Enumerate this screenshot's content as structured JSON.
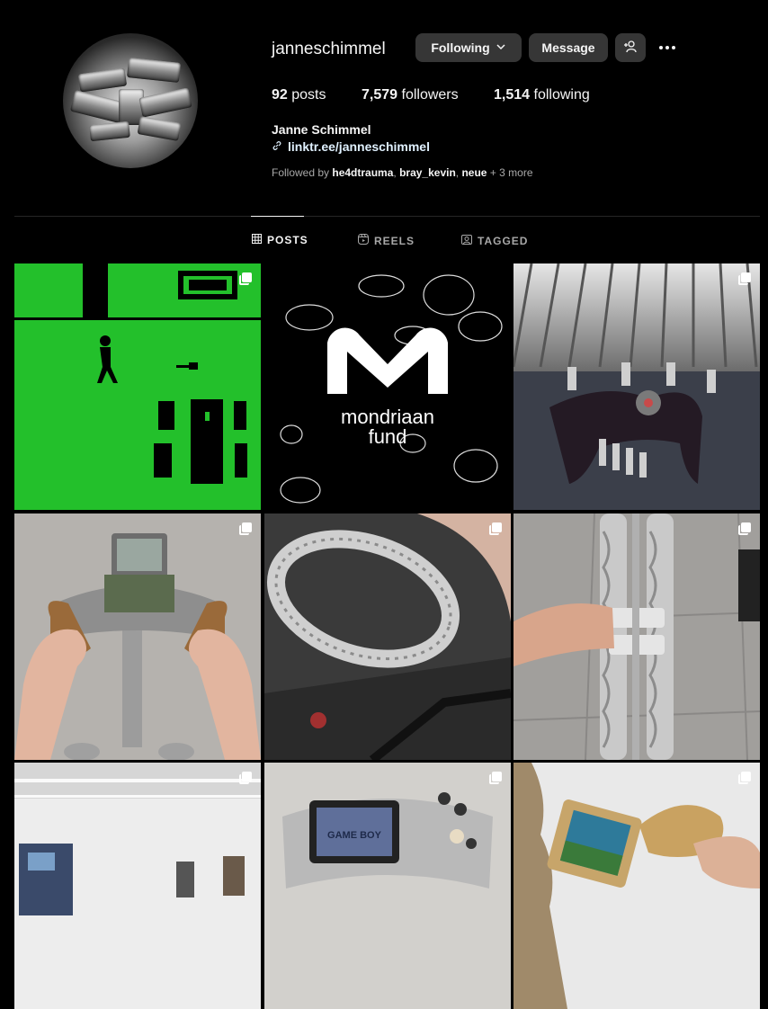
{
  "profile": {
    "username": "janneschimmel",
    "full_name": "Janne Schimmel",
    "link": "linktr.ee/janneschimmel",
    "stats": {
      "posts_count": "92",
      "posts_label": "posts",
      "followers_count": "7,579",
      "followers_label": "followers",
      "following_count": "1,514",
      "following_label": "following"
    },
    "followed_by": {
      "prefix": "Followed by",
      "users": [
        "he4dtrauma",
        "bray_kevin",
        "neue"
      ],
      "more": "+ 3 more"
    }
  },
  "actions": {
    "following_label": "Following",
    "message_label": "Message"
  },
  "tabs": [
    {
      "label": "POSTS",
      "icon": "grid-icon",
      "active": true
    },
    {
      "label": "REELS",
      "icon": "reels-icon",
      "active": false
    },
    {
      "label": "TAGGED",
      "icon": "tagged-icon",
      "active": false
    }
  ],
  "posts": [
    {
      "desc": "green pixel game screen",
      "multi": true
    },
    {
      "desc": "mondriaan fund graphic",
      "text": "mondriaan fund",
      "multi": false
    },
    {
      "desc": "aluminium radiator sculpture",
      "multi": true
    },
    {
      "desc": "metal game controller sculpture",
      "multi": true
    },
    {
      "desc": "cast metal chair ring",
      "multi": true
    },
    {
      "desc": "cast metal door handles",
      "multi": true
    },
    {
      "desc": "gallery installation",
      "multi": true
    },
    {
      "desc": "game boy sculpture",
      "gameboy_text": "GAME BOY",
      "multi": true
    },
    {
      "desc": "sculpture with photo frame",
      "multi": true
    }
  ],
  "colors": {
    "background": "#000000",
    "button": "#363636",
    "link": "#e0f1ff",
    "muted": "#a8a8a8",
    "game_green": "#23c02b"
  }
}
